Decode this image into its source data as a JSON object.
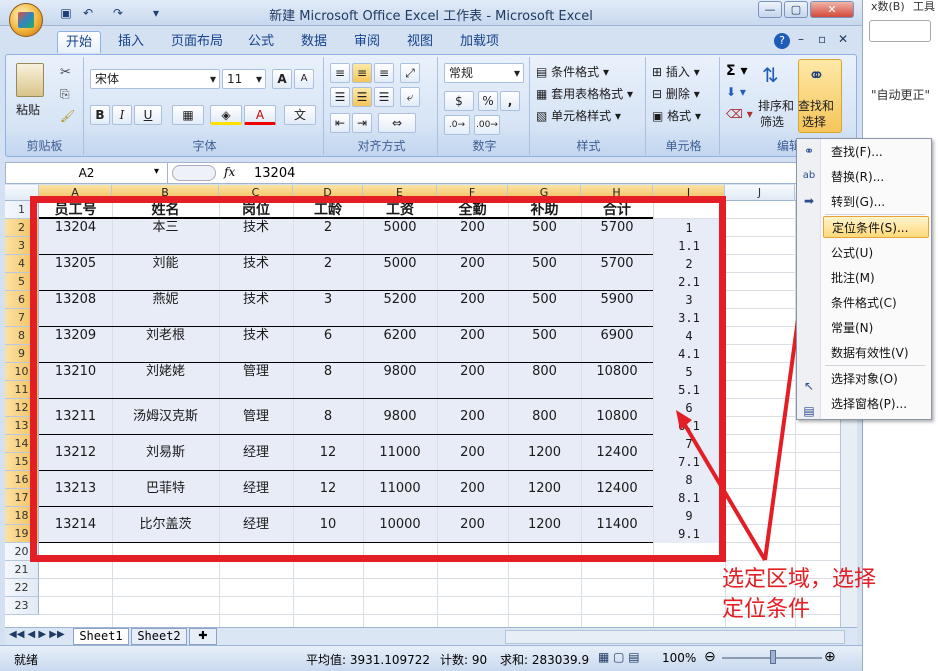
{
  "window": {
    "title": "新建 Microsoft Office Excel 工作表 - Microsoft Excel"
  },
  "right_strip": {
    "text1": "x数(B)",
    "text2": "工具",
    "text3": "\"自动更正\""
  },
  "tabs": [
    "开始",
    "插入",
    "页面布局",
    "公式",
    "数据",
    "审阅",
    "视图",
    "加载项"
  ],
  "ribbon": {
    "clipboard": {
      "paste": "粘贴",
      "label": "剪贴板"
    },
    "font": {
      "name": "宋体",
      "size": "11",
      "label": "字体",
      "bold": "B",
      "italic": "I",
      "underline": "U",
      "wen": "文"
    },
    "alignment": {
      "label": "对齐方式"
    },
    "number": {
      "format": "常规",
      "label": "数字",
      "percent": "%",
      "comma": ","
    },
    "styles": {
      "cond": "条件格式",
      "table": "套用表格格式",
      "cell": "单元格样式",
      "label": "样式"
    },
    "cells": {
      "insert": "插入",
      "delete": "删除",
      "format": "格式",
      "label": "单元格"
    },
    "editing": {
      "sort": "排序和",
      "sort2": "筛选",
      "find": "查找和",
      "find2": "选择",
      "label": "编辑"
    }
  },
  "formula_bar": {
    "namebox": "A2",
    "fx": "fx",
    "value": "13204"
  },
  "columns": [
    "A",
    "B",
    "C",
    "D",
    "E",
    "F",
    "G",
    "H",
    "I",
    "J"
  ],
  "rows": [
    "1",
    "2",
    "3",
    "4",
    "5",
    "6",
    "7",
    "8",
    "9",
    "10",
    "11",
    "12",
    "13",
    "14",
    "15",
    "16",
    "17",
    "18",
    "19",
    "20",
    "21",
    "22",
    "23"
  ],
  "table": {
    "headers": [
      "员工号",
      "姓名",
      "岗位",
      "工龄",
      "工资",
      "全勤",
      "补助",
      "合计"
    ],
    "records": [
      [
        "13204",
        "本三",
        "技术",
        "2",
        "5000",
        "200",
        "500",
        "5700"
      ],
      [
        "13205",
        "刘能",
        "技术",
        "2",
        "5000",
        "200",
        "500",
        "5700"
      ],
      [
        "13208",
        "燕妮",
        "技术",
        "3",
        "5200",
        "200",
        "500",
        "5900"
      ],
      [
        "13209",
        "刘老根",
        "技术",
        "6",
        "6200",
        "200",
        "500",
        "6900"
      ],
      [
        "13210",
        "刘姥姥",
        "管理",
        "8",
        "9800",
        "200",
        "800",
        "10800"
      ],
      [
        "13211",
        "汤姆汉克斯",
        "管理",
        "8",
        "9800",
        "200",
        "800",
        "10800"
      ],
      [
        "13212",
        "刘易斯",
        "经理",
        "12",
        "11000",
        "200",
        "1200",
        "12400"
      ],
      [
        "13213",
        "巴菲特",
        "经理",
        "12",
        "11000",
        "200",
        "1200",
        "12400"
      ],
      [
        "13214",
        "比尔盖茨",
        "经理",
        "10",
        "10000",
        "200",
        "1200",
        "11400"
      ]
    ],
    "i_values": [
      "1",
      "1.1",
      "2",
      "2.1",
      "3",
      "3.1",
      "4",
      "4.1",
      "5",
      "5.1",
      "6",
      "6.1",
      "7",
      "7.1",
      "8",
      "8.1",
      "9",
      "9.1"
    ]
  },
  "menu": [
    "查找(F)...",
    "替换(R)...",
    "转到(G)...",
    "定位条件(S)...",
    "公式(U)",
    "批注(M)",
    "条件格式(C)",
    "常量(N)",
    "数据有效性(V)",
    "选择对象(O)",
    "选择窗格(P)..."
  ],
  "sheets": [
    "Sheet1",
    "Sheet2"
  ],
  "status": {
    "ready": "就绪",
    "avg": "平均值: 3931.109722",
    "count": "计数: 90",
    "sum": "求和: 283039.9",
    "zoom": "100%"
  },
  "annotation": {
    "line1": "选定区域，选择",
    "line2": "定位条件"
  },
  "colors": {
    "accent_red": "#e31e24",
    "selection_fill": "#e8ecf7",
    "header_highlight": "#f2bd5a"
  }
}
